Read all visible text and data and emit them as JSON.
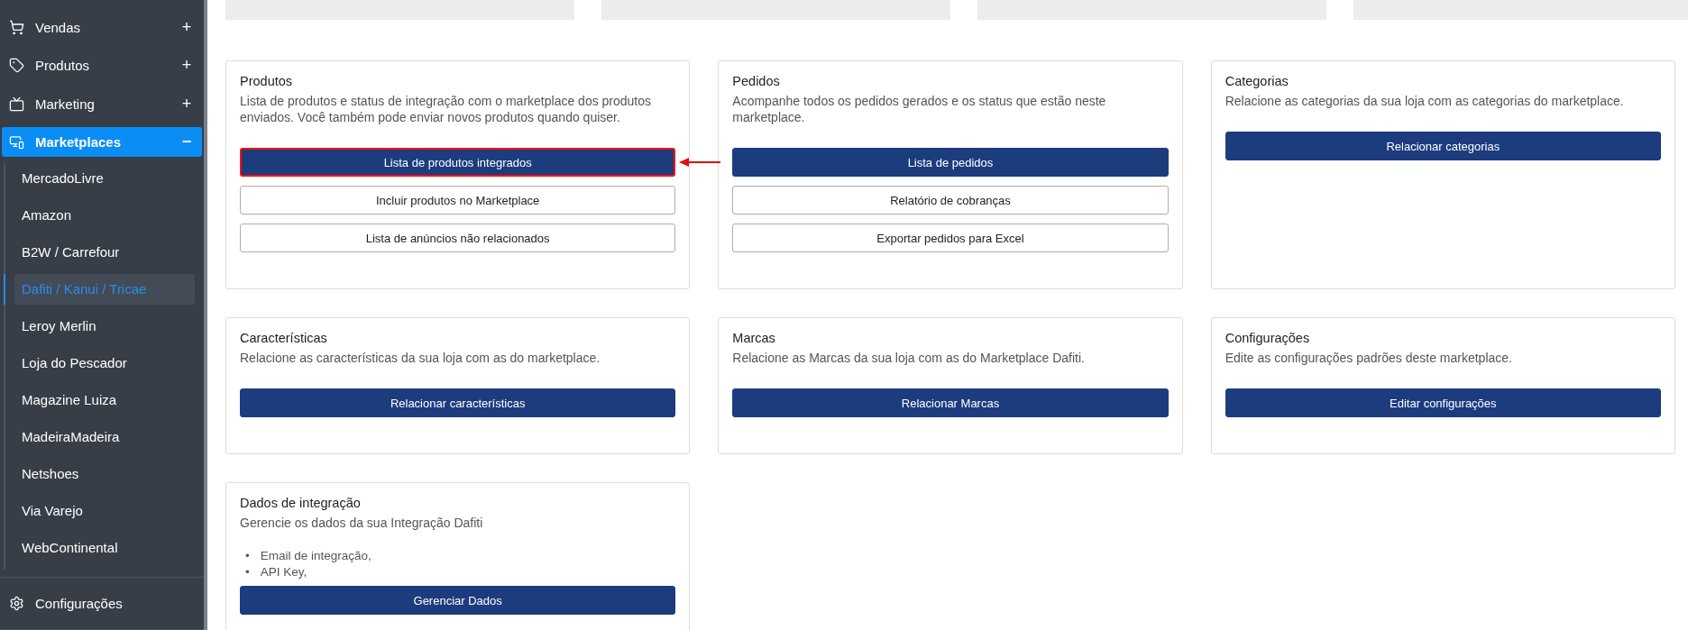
{
  "sidebar": {
    "items": [
      {
        "label": "Vendas",
        "toggle": "+",
        "selected": false
      },
      {
        "label": "Produtos",
        "toggle": "+",
        "selected": false
      },
      {
        "label": "Marketing",
        "toggle": "+",
        "selected": false
      },
      {
        "label": "Marketplaces",
        "toggle": "−",
        "selected": true,
        "children": [
          {
            "label": "MercadoLivre",
            "selected": false
          },
          {
            "label": "Amazon",
            "selected": false
          },
          {
            "label": "B2W / Carrefour",
            "selected": false
          },
          {
            "label": "Dafiti / Kanui / Tricae",
            "selected": true
          },
          {
            "label": "Leroy Merlin",
            "selected": false
          },
          {
            "label": "Loja do Pescador",
            "selected": false
          },
          {
            "label": "Magazine Luiza",
            "selected": false
          },
          {
            "label": "MadeiraMadeira",
            "selected": false
          },
          {
            "label": "Netshoes",
            "selected": false
          },
          {
            "label": "Via Varejo",
            "selected": false
          },
          {
            "label": "WebContinental",
            "selected": false
          }
        ]
      }
    ],
    "footer_item": {
      "label": "Configurações"
    }
  },
  "top_placeholders": [
    {
      "kind": "placeholder"
    },
    {
      "kind": "placeholder"
    },
    {
      "kind": "placeholder"
    },
    {
      "kind": "placeholder"
    }
  ],
  "cards": [
    {
      "title": "Produtos",
      "description": "Lista de produtos e status de integração com o marketplace dos produtos enviados. Você também pode enviar novos produtos quando quiser.",
      "buttons": [
        {
          "label": "Lista de produtos integrados",
          "kind": "primary",
          "highlighted": true
        },
        {
          "label": "Incluir produtos no Marketplace",
          "kind": "outline",
          "highlighted": false
        },
        {
          "label": "Lista de anúncios não relacionados",
          "kind": "outline",
          "highlighted": false
        }
      ]
    },
    {
      "title": "Pedidos",
      "description": "Acompanhe todos os pedidos gerados e os status que estão neste marketplace.",
      "buttons": [
        {
          "label": "Lista de pedidos",
          "kind": "primary",
          "highlighted": false
        },
        {
          "label": "Relatório de cobranças",
          "kind": "outline",
          "highlighted": false
        },
        {
          "label": "Exportar pedidos para Excel",
          "kind": "outline",
          "highlighted": false
        }
      ]
    },
    {
      "title": "Categorias",
      "description": "Relacione as categorias da sua loja com as categorias do marketplace.",
      "buttons": [
        {
          "label": "Relacionar categorias",
          "kind": "primary",
          "highlighted": false
        }
      ]
    },
    {
      "title": "Características",
      "description": "Relacione as características da sua loja com as do marketplace.",
      "buttons": [
        {
          "label": "Relacionar características",
          "kind": "primary",
          "highlighted": false
        }
      ]
    },
    {
      "title": "Marcas",
      "description": "Relacione as Marcas da sua loja com as do Marketplace Dafiti.",
      "buttons": [
        {
          "label": "Relacionar Marcas",
          "kind": "primary",
          "highlighted": false
        }
      ]
    },
    {
      "title": "Configurações",
      "description": "Edite as configurações padrões deste marketplace.",
      "buttons": [
        {
          "label": "Editar configurações",
          "kind": "primary",
          "highlighted": false
        }
      ]
    },
    {
      "title": "Dados de integração",
      "description": "Gerencie os dados da sua Integração Dafiti",
      "bullets": [
        {
          "marker": "•",
          "text": "Email de integração,"
        },
        {
          "marker": "•",
          "text": "API Key,"
        }
      ],
      "buttons": [
        {
          "label": "Gerenciar Dados",
          "kind": "primary",
          "highlighted": false
        }
      ]
    }
  ]
}
